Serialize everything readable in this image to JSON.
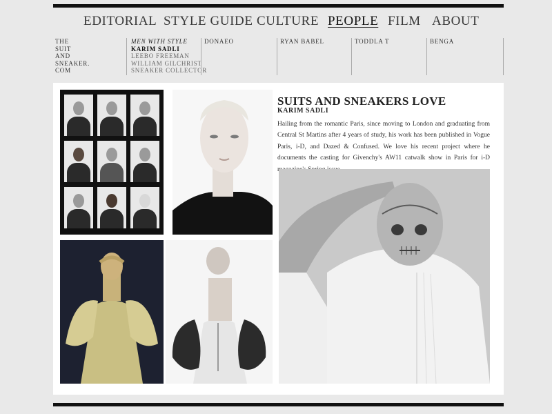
{
  "nav": {
    "items": [
      {
        "label": "EDITORIAL",
        "active": false
      },
      {
        "label": "STYLE GUIDE",
        "active": false
      },
      {
        "label": "CULTURE",
        "active": false
      },
      {
        "label": "PEOPLE",
        "active": true
      },
      {
        "label": "FILM",
        "active": false
      },
      {
        "label": "ABOUT",
        "active": false
      }
    ]
  },
  "subnav": {
    "logo_lines": [
      "THE",
      "SUIT",
      "AND",
      "SNEAKER.",
      "COM"
    ],
    "feature_heading": "MEN WITH STYLE",
    "feature_current": "KARIM SADLI",
    "feature_items": [
      "LEEBO FREEMAN",
      "WILLIAM GILCHRIST",
      "SNEAKER COLLECTOR"
    ],
    "columns": [
      "DONAEO",
      "RYAN BABEL",
      "TODDLA T",
      "BENGA"
    ]
  },
  "article": {
    "title": "SUITS AND SNEAKERS LOVE",
    "subtitle": "KARIM SADLI",
    "body": "Hailing from the romantic Paris, since moving to London and graduating from Central St Martins after 4 years of study, his work has been published in Vogue Paris, i-D, and Dazed & Confused. We love his recent project where he documents the casting for Givenchy's AW11 catwalk show in Paris for i-D magazine's Spring issue."
  },
  "images": [
    {
      "icon": "model-casting-grid-photo"
    },
    {
      "icon": "blond-model-portrait-photo"
    },
    {
      "icon": "gold-gown-photo"
    },
    {
      "icon": "corset-dress-photo"
    },
    {
      "icon": "tattooed-skull-model-photo"
    }
  ],
  "colors": {
    "page_background": "#e9e9e9",
    "rule": "#111111",
    "text": "#222222"
  }
}
